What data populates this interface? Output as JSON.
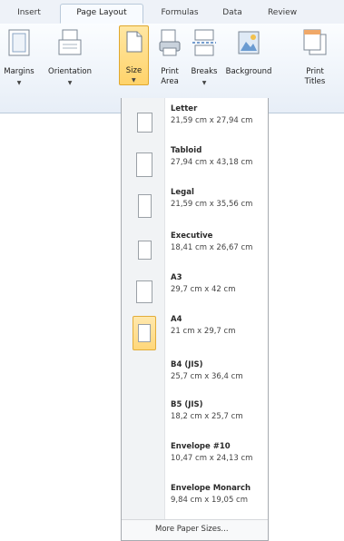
{
  "tabs": [
    {
      "label": "Insert"
    },
    {
      "label": "Page Layout",
      "active": true
    },
    {
      "label": "Formulas"
    },
    {
      "label": "Data"
    },
    {
      "label": "Review"
    }
  ],
  "ribbon": {
    "margins": {
      "label": "Margins",
      "icon": "margins-icon"
    },
    "orientation": {
      "label": "Orientation",
      "icon": "orientation-icon"
    },
    "size": {
      "label": "Size",
      "icon": "page-size-icon"
    },
    "print_area": {
      "label_line1": "Print",
      "label_line2": "Area",
      "icon": "print-area-icon"
    },
    "breaks": {
      "label": "Breaks",
      "icon": "breaks-icon"
    },
    "background": {
      "label": "Background",
      "icon": "background-icon"
    },
    "print_titles": {
      "label_line1": "Print",
      "label_line2": "Titles",
      "icon": "print-titles-icon"
    }
  },
  "size_menu": {
    "items": [
      {
        "name": "Letter",
        "dims": "21,59 cm x 27,94 cm"
      },
      {
        "name": "Tabloid",
        "dims": "27,94 cm x 43,18 cm"
      },
      {
        "name": "Legal",
        "dims": "21,59 cm x 35,56 cm"
      },
      {
        "name": "Executive",
        "dims": "18,41 cm x 26,67 cm"
      },
      {
        "name": "A3",
        "dims": "29,7 cm x 42 cm"
      },
      {
        "name": "A4",
        "dims": "21 cm x 29,7 cm",
        "selected": true
      },
      {
        "name": "B4 (JIS)",
        "dims": "25,7 cm x 36,4 cm"
      },
      {
        "name": "B5 (JIS)",
        "dims": "18,2 cm x 25,7 cm"
      },
      {
        "name": "Envelope #10",
        "dims": "10,47 cm x 24,13 cm"
      },
      {
        "name": "Envelope Monarch",
        "dims": "9,84 cm x 19,05 cm"
      }
    ],
    "more_label": "More Paper Sizes..."
  },
  "colors": {
    "accent": "#ffd36b",
    "accent_border": "#e0a82e"
  }
}
